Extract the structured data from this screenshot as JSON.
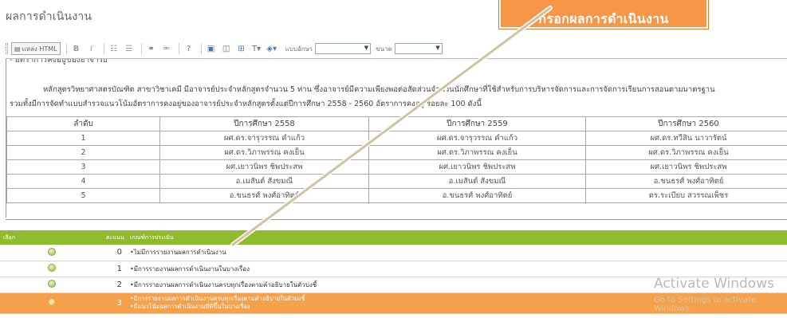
{
  "page": {
    "title": "ผลการดำเนินงาน"
  },
  "callout": {
    "text": "กรอกผลการดำเนินงาน"
  },
  "toolbar": {
    "source_label": "แหล่ง HTML",
    "bold": "B",
    "italic": "I",
    "font_label": "แบบอักษร",
    "font_value": "",
    "size_label": "ขนาด",
    "size_value": ""
  },
  "editor": {
    "cut_heading": "- อัตราการคงอยู่ของอาจารย์",
    "para_line1": "หลักสูตรวิทยาศาสตรบัณฑิต สาขาวิชาเคมี มีอาจารย์ประจำหลักสูตรจำนวน 5 ท่าน ซึ่งอาจารย์มีความเพียงพอต่อสัดส่วนจำนวนนักศึกษาที่ใช้สำหรับการบริหารจัดการและการจัดการเรียนการสอนตามมาตรฐาน",
    "para_line2": "รวมทั้งมีการจัดทำแบบสำรวจแนวโน้มอัตราการคงอยู่ของอาจารย์ประจำหลักสูตรตั้งแต่ปีการศึกษา 2558 - 2560 อัตราการคงอยู่ ร้อยละ 100 ดังนี้",
    "table": {
      "headers": [
        "ลำดับ",
        "ปีการศึกษา 2558",
        "ปีการศึกษา 2559",
        "ปีการศึกษา 2560"
      ],
      "rows": [
        [
          "1",
          "ผศ.ดร.จารุวรรณ คำแก้ว",
          "ผศ.ดร.จารุวรรณ คำแก้ว",
          "ผศ.ดร.ทวีสิน นาวารัตน์"
        ],
        [
          "2",
          "ผศ.ดร.วิภาพรรณ คงเย็น",
          "ผศ.ดร.วิภาพรรณ คงเย็น",
          "ผศ.ดร.วิภาพรรณ คงเย็น"
        ],
        [
          "3",
          "ผศ.เยาวนิพร ชิพประสพ",
          "ผศ.เยาวนิพร ชิพประสพ",
          "ผศ.เยาวนิพร ชิพประสพ"
        ],
        [
          "4",
          "อ.เมสันต์ สังขมณี",
          "อ.เมสันต์ สังขมณี",
          "อ.ขนธรศ์ พงศ์อาทิตย์"
        ],
        [
          "5",
          "อ.ขนธรศ์ พงศ์อาทิตย์",
          "อ.ขนธรศ์ พงศ์อาทิตย์",
          "ดร.ระเบียบ สวรรณเพ็ชร"
        ]
      ]
    }
  },
  "rubric": {
    "headers": [
      "เลือก",
      "คะแนน",
      "เกณฑ์การประเมิน"
    ],
    "rows": [
      {
        "score": "0",
        "desc": "ไม่มีการรายงานผลการดำเนินงาน",
        "desc2": "",
        "selected": false
      },
      {
        "score": "1",
        "desc": "มีการรายงานผลการดำเนินงานในบางเรื่อง",
        "desc2": "",
        "selected": false
      },
      {
        "score": "2",
        "desc": "มีการรายงานผลการดำเนินงานครบทุกเรื่องตามคำอธิบายในตัวบ่งชี้",
        "desc2": "",
        "selected": false
      },
      {
        "score": "3",
        "desc": "มีการรายงานผลการดำเนินงานครบทุกเรื่องตามคำอธิบายในตัวบ่งชี้",
        "desc2": "มีแนวโน้มผลการดำเนินงานที่ดีขึ้นในบางเรื่อง",
        "selected": true
      }
    ]
  },
  "watermark": {
    "title": "Activate Windows",
    "subtitle": "Go to Settings to activate Windows."
  },
  "colors": {
    "callout": "#f79646",
    "rubric_header": "#8fbc2e",
    "selected_row": "#f5a04a"
  }
}
